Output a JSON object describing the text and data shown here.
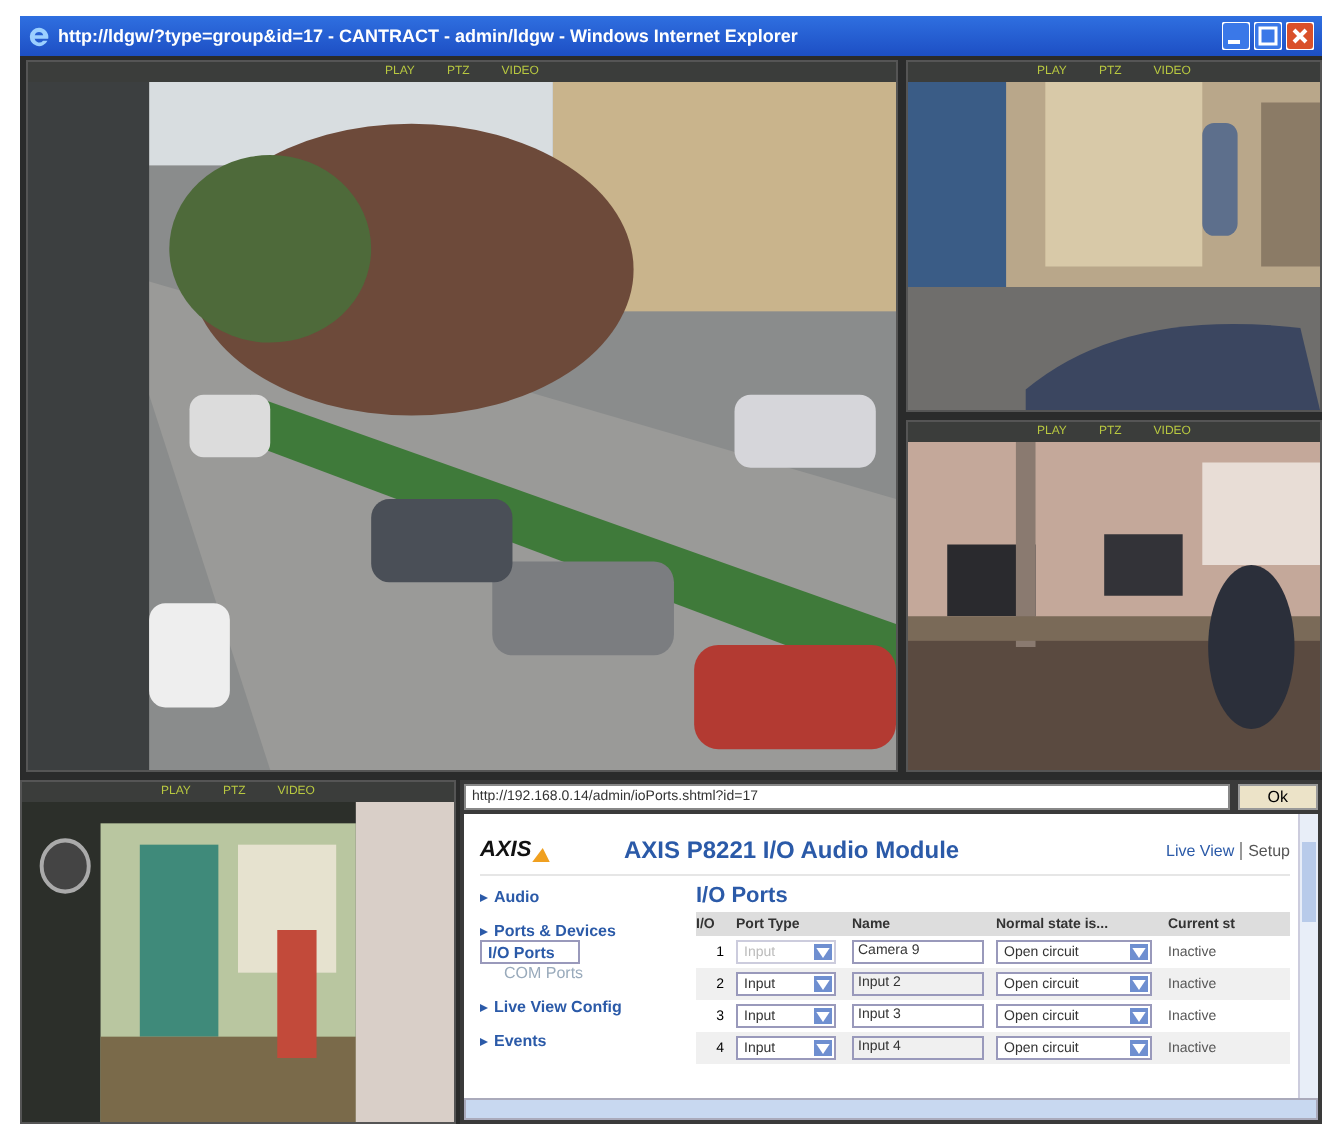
{
  "window": {
    "title": "http://ldgw/?type=group&id=17 - CANTRACT - admin/ldgw - Windows Internet Explorer"
  },
  "cameras": [
    {
      "controls": [
        "PLAY",
        "PTZ",
        "VIDEO"
      ]
    },
    {
      "controls": [
        "PLAY",
        "PTZ",
        "VIDEO"
      ]
    },
    {
      "controls": [
        "PLAY",
        "PTZ",
        "VIDEO"
      ]
    },
    {
      "controls": [
        "PLAY",
        "PTZ",
        "VIDEO"
      ]
    }
  ],
  "browser": {
    "address": "http://192.168.0.14/admin/ioPorts.shtml?id=17",
    "go_button": "Ok",
    "logo": "AXIS",
    "product_title": "AXIS P8221 I/O Audio Module",
    "top_links": [
      "Live View",
      "Setup"
    ],
    "sidebar": [
      {
        "label": "Audio"
      },
      {
        "label": "Ports & Devices",
        "children": [
          {
            "label": "I/O Ports",
            "selected": true
          },
          {
            "label": "COM Ports",
            "selected": false
          }
        ]
      },
      {
        "label": "Live View Config"
      },
      {
        "label": "Events"
      }
    ],
    "heading": "I/O Ports",
    "table": {
      "columns": [
        "I/O",
        "Port Type",
        "Name",
        "Normal state is...",
        "Current st"
      ],
      "rows": [
        {
          "io": "1",
          "port_type": "Input",
          "disabled": true,
          "name": "Camera 9",
          "normal_state": "Open circuit",
          "current": "Inactive"
        },
        {
          "io": "2",
          "port_type": "Input",
          "disabled": false,
          "name": "Input 2",
          "normal_state": "Open circuit",
          "current": "Inactive"
        },
        {
          "io": "3",
          "port_type": "Input",
          "disabled": false,
          "name": "Input 3",
          "normal_state": "Open circuit",
          "current": "Inactive"
        },
        {
          "io": "4",
          "port_type": "Input",
          "disabled": false,
          "name": "Input 4",
          "normal_state": "Open circuit",
          "current": "Inactive"
        }
      ]
    }
  }
}
